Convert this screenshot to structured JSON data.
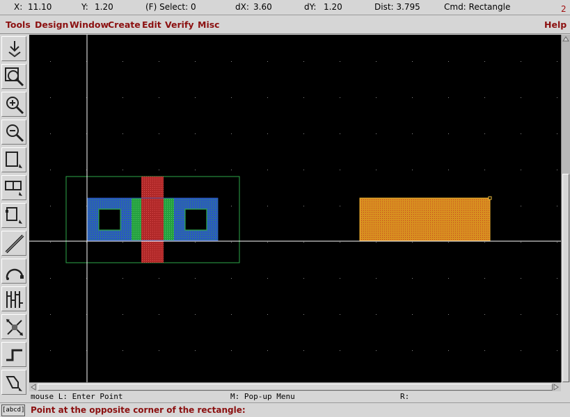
{
  "status": {
    "x_label": "X:",
    "x_value": "11.10",
    "y_label": "Y:",
    "y_value": "1.20",
    "select": "(F) Select: 0",
    "dx_label": "dX:",
    "dx_value": "3.60",
    "dy_label": "dY:",
    "dy_value": "1.20",
    "dist": "Dist: 3.795",
    "cmd": "Cmd: Rectangle",
    "window_number": "2"
  },
  "menu": {
    "items": [
      "Tools",
      "Design",
      "Window",
      "Create",
      "Edit",
      "Verify",
      "Misc"
    ],
    "help": "Help"
  },
  "toolbar": {
    "tools": [
      "save-icon",
      "zoom-fit-icon",
      "zoom-in-icon",
      "zoom-out-icon",
      "pan-icon",
      "window-select-icon",
      "redraw-icon",
      "wire-icon",
      "arc-icon",
      "array-icon",
      "transform-icon",
      "path-icon",
      "polygon-icon"
    ]
  },
  "colors": {
    "canvas_bg": "#000000",
    "grid_dot": "#8a8a8a",
    "crosshair": "#ffffff",
    "boundary_green": "#2ea84a",
    "poly_red": "#c83030",
    "diffusion_green": "#28a040",
    "contact_blue": "#2e5ec8",
    "active_orange": "#e8a020",
    "menu_text": "#8b1010"
  },
  "mouse_help": {
    "left": "mouse L: Enter Point",
    "middle": "M: Pop-up Menu",
    "right": "R:"
  },
  "prompt": {
    "button_label": "[abcd]",
    "text": "Point at the opposite corner of the rectangle:"
  }
}
